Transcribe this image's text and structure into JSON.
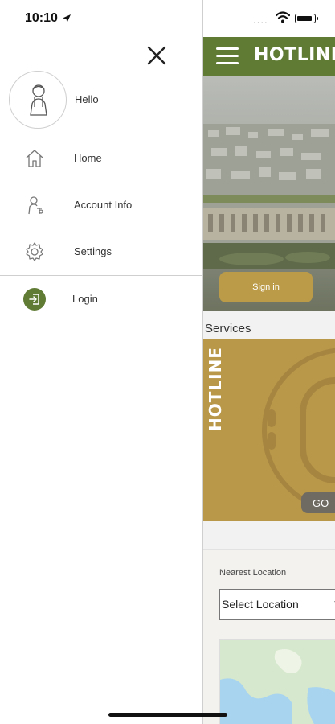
{
  "status_bar": {
    "time": "10:10"
  },
  "drawer": {
    "greeting": "Hello",
    "menu": [
      {
        "label": "Home",
        "icon": "home-icon"
      },
      {
        "label": "Account Info",
        "icon": "account-info-icon"
      },
      {
        "label": "Settings",
        "icon": "gear-icon"
      }
    ],
    "login": {
      "label": "Login",
      "icon": "login-icon"
    }
  },
  "app": {
    "header_title": "HOTLINE",
    "hero": {
      "sign_in_label": "Sign in"
    },
    "services_title": "Services",
    "hotline_card": {
      "title": "HOTLINE",
      "go_label": "GO"
    },
    "location": {
      "label": "Nearest Location",
      "select_value": "Select Location"
    }
  },
  "colors": {
    "brand_green": "#5f7b34",
    "brand_gold": "#bb9b48",
    "go_gray": "#6f6a62"
  }
}
